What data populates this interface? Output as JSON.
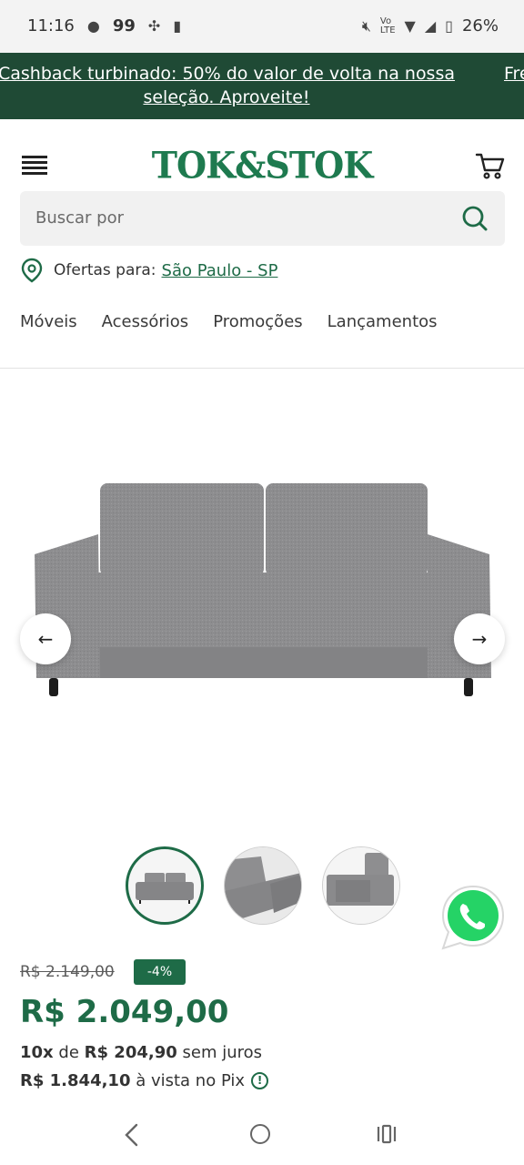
{
  "status_bar": {
    "time": "11:16",
    "badge_count": "99",
    "battery": "26%"
  },
  "promo": {
    "text": "Cashback turbinado: 50% do valor de volta na nossa seleção. Aproveite!",
    "next_text": "Frete"
  },
  "header": {
    "logo": "TOK&STOK"
  },
  "search": {
    "placeholder": "Buscar por"
  },
  "location": {
    "label": "Ofertas para:",
    "city": "São Paulo - SP"
  },
  "nav": {
    "items": [
      "Móveis",
      "Acessórios",
      "Promoções",
      "Lançamentos"
    ]
  },
  "pricing": {
    "old_price": "R$ 2.149,00",
    "discount": "-4%",
    "price": "R$ 2.049,00",
    "installments_count": "10x",
    "installments_mid": "de",
    "installments_value": "R$ 204,90",
    "installments_suffix": "sem juros",
    "pix_value": "R$ 1.844,10",
    "pix_suffix": "à vista no Pix"
  },
  "colors": {
    "brand_green": "#1e6b47",
    "banner_green": "#1f4a35",
    "whatsapp_green": "#25d366"
  }
}
